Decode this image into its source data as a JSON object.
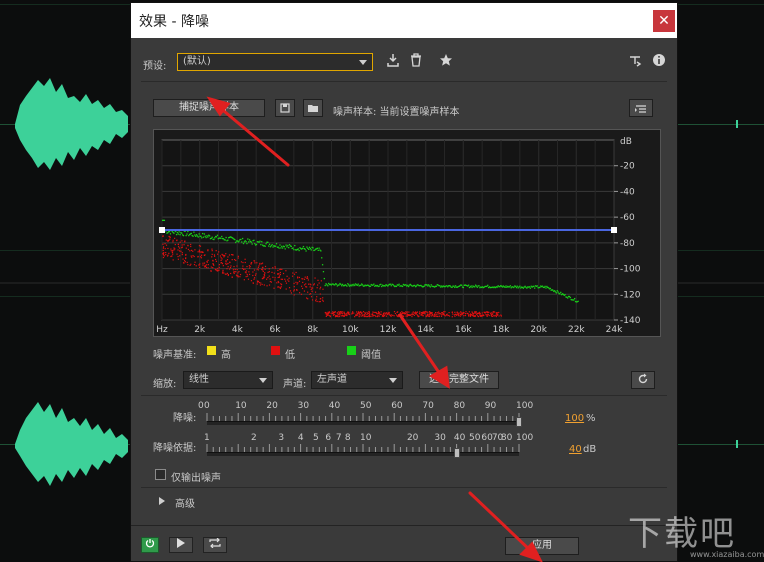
{
  "dialog": {
    "title": "效果 - 降噪",
    "close_label": "✕"
  },
  "preset": {
    "label": "预设:",
    "value": "(默认)"
  },
  "toolbar_icons": [
    "save-preset-icon",
    "delete-icon",
    "favorite-star-icon",
    "routing-icon",
    "info-icon"
  ],
  "capture": {
    "button": "捕捉噪声样本",
    "sample_label": "噪声样本: 当前设置噪声样本"
  },
  "graph": {
    "y_axis_title": "dB",
    "y_ticks": [
      "-20",
      "-40",
      "-60",
      "-80",
      "-100",
      "-120",
      "-140"
    ],
    "x_ticks": [
      "Hz",
      "2k",
      "4k",
      "6k",
      "8k",
      "10k",
      "12k",
      "14k",
      "16k",
      "18k",
      "20k",
      "22k",
      "24k"
    ],
    "threshold_db": -70
  },
  "legend": {
    "title": "噪声基准:",
    "items": [
      {
        "label": "高",
        "color": "#f2e01a"
      },
      {
        "label": "低",
        "color": "#e01010"
      },
      {
        "label": "阈值",
        "color": "#18d018"
      }
    ]
  },
  "scale": {
    "label": "缩放:",
    "value": "线性"
  },
  "channel": {
    "label": "声道:",
    "value": "左声道"
  },
  "select_file_button": "选择完整文件",
  "reduction": {
    "label": "降噪:",
    "ticks": [
      "0",
      "0",
      "10",
      "20",
      "30",
      "40",
      "50",
      "60",
      "70",
      "80",
      "90",
      "100"
    ],
    "value": "100",
    "unit": "%",
    "level": 1.0
  },
  "reduce_by": {
    "label": "降噪依据:",
    "ticks": [
      "1",
      "2",
      "3",
      "4",
      "5",
      "6",
      "7",
      "8",
      "10",
      "20",
      "30",
      "40",
      "50",
      "60",
      "70",
      "80",
      "100"
    ],
    "value": "40",
    "unit": "dB"
  },
  "output_noise": {
    "label": "仅输出噪声",
    "checked": false
  },
  "advanced": {
    "label": "高级"
  },
  "apply_button": "应用",
  "watermark": {
    "big": "下载吧",
    "small": "www.xiazaiba.com"
  }
}
